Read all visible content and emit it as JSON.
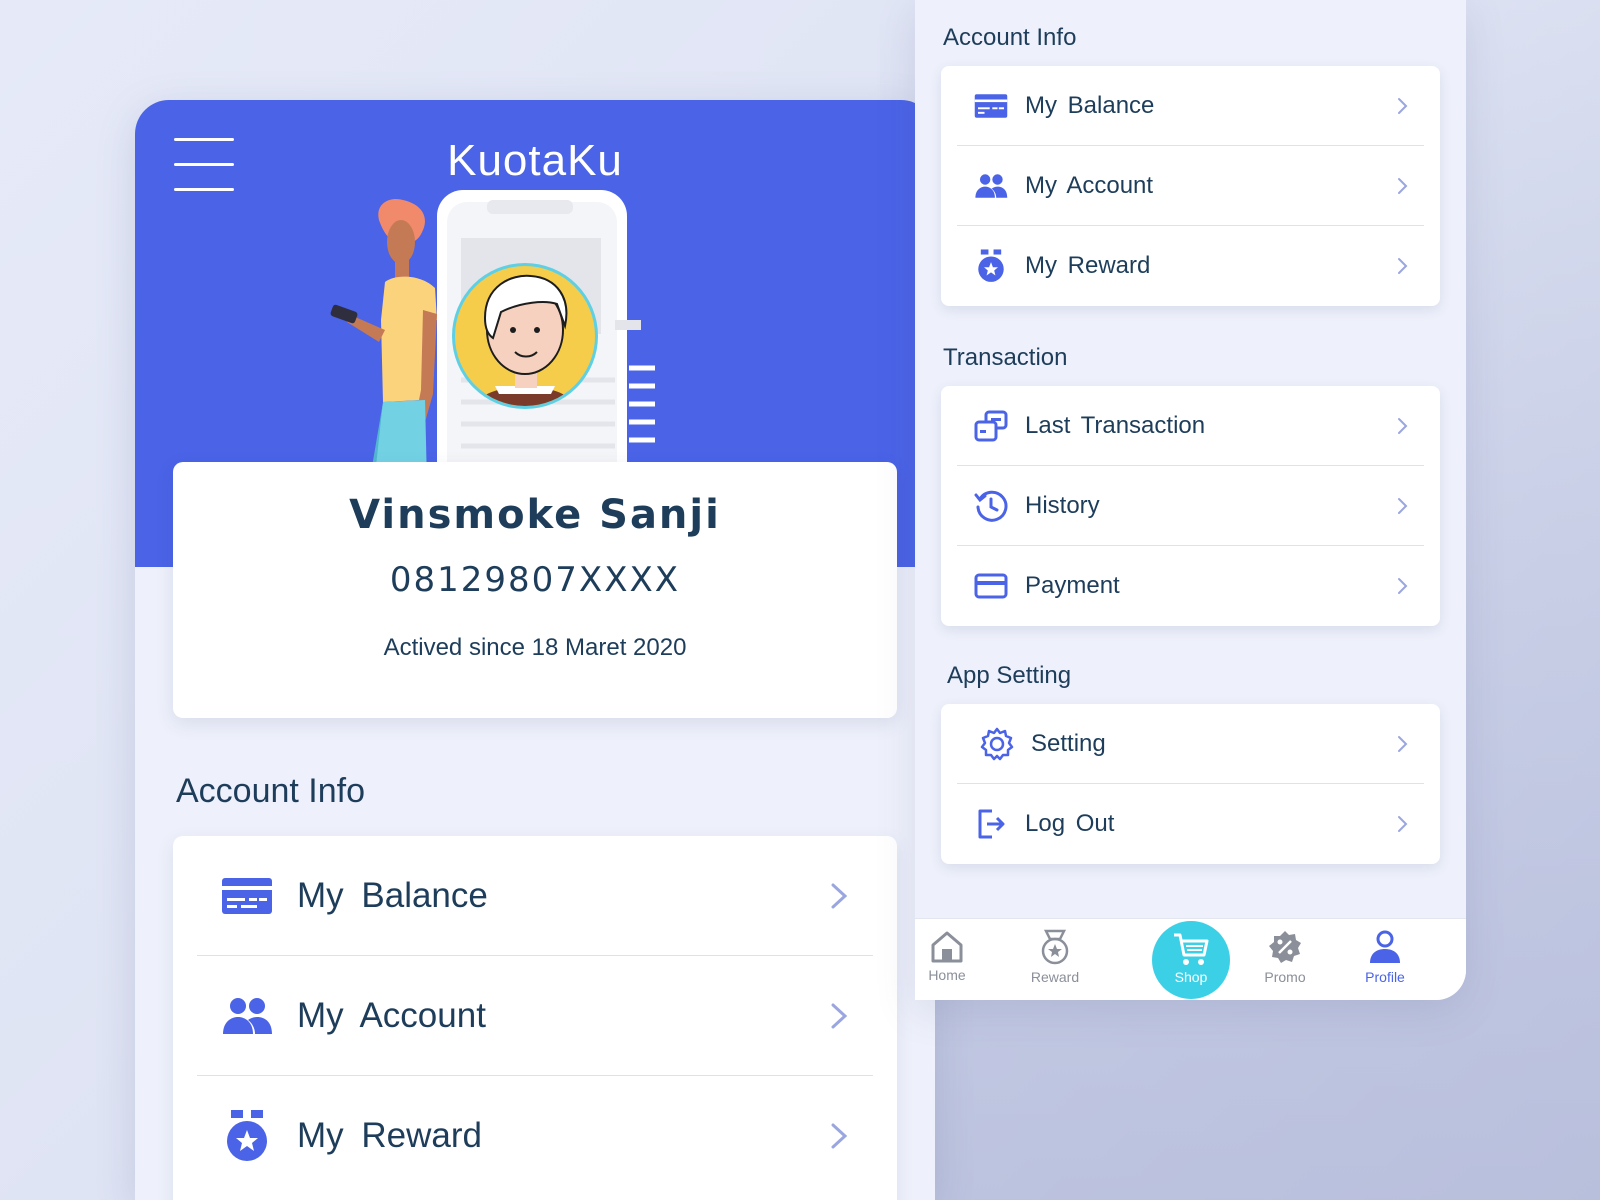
{
  "app": {
    "title": "KuotaKu"
  },
  "colors": {
    "primary": "#4a63e7",
    "accent": "#3cd0e6",
    "text": "#1d3d5a",
    "background": "#eef1fb"
  },
  "profile": {
    "name": "Vinsmoke Sanji",
    "phone": "08129807XXXX",
    "since": "Actived since 18 Maret 2020"
  },
  "left": {
    "section_title": "Account Info",
    "items": [
      {
        "label": "My Balance",
        "icon": "wallet-icon"
      },
      {
        "label": "My  Account",
        "icon": "users-icon"
      },
      {
        "label": "My  Reward",
        "icon": "medal-icon"
      }
    ]
  },
  "right": {
    "sections": [
      {
        "title": "Account Info",
        "items": [
          {
            "label": "My Balance",
            "icon": "wallet-icon"
          },
          {
            "label": "My  Account",
            "icon": "users-icon"
          },
          {
            "label": "My  Reward",
            "icon": "medal-icon"
          }
        ]
      },
      {
        "title": "Transaction",
        "items": [
          {
            "label": "Last Transaction",
            "icon": "transaction-icon"
          },
          {
            "label": "History",
            "icon": "history-icon"
          },
          {
            "label": "Payment",
            "icon": "credit-card-icon"
          }
        ]
      },
      {
        "title": "App Setting",
        "items": [
          {
            "label": "Setting",
            "icon": "gear-icon"
          },
          {
            "label": "Log Out",
            "icon": "logout-icon"
          }
        ]
      }
    ]
  },
  "nav": {
    "home": "Home",
    "reward": "Reward",
    "shop": "Shop",
    "promo": "Promo",
    "profile": "Profile",
    "active": "Profile"
  }
}
